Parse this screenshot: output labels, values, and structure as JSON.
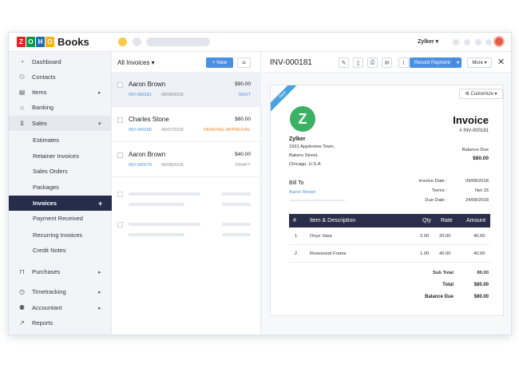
{
  "brand": {
    "logo_letters": [
      "Z",
      "O",
      "H",
      "O"
    ],
    "logo_colors": [
      "#e42527",
      "#089949",
      "#226db4",
      "#f9b21d"
    ],
    "product": "Books",
    "accent": "#4a90e2",
    "nav_active_bg": "#252d4a"
  },
  "topbar": {
    "org_name": "Zylker ▾"
  },
  "sidebar": {
    "items": [
      {
        "icon": "dashboard-icon",
        "label": "Dashboard"
      },
      {
        "icon": "contacts-icon",
        "label": "Contacts"
      },
      {
        "icon": "items-icon",
        "label": "Items",
        "chevron": "▸"
      },
      {
        "icon": "banking-icon",
        "label": "Banking"
      },
      {
        "icon": "cart-icon",
        "label": "Sales",
        "chevron": "▾"
      },
      {
        "label": "Estimates"
      },
      {
        "label": "Retainer Invoices"
      },
      {
        "label": "Sales Orders"
      },
      {
        "label": "Packages"
      },
      {
        "label": "Invoices",
        "chevron": "+"
      },
      {
        "label": "Payment Received"
      },
      {
        "label": "Recurring Invoices"
      },
      {
        "label": "Credit Notes"
      },
      {
        "icon": "bag-icon",
        "label": "Purchases",
        "chevron": "▸"
      },
      {
        "icon": "timer-icon",
        "label": "Timetracking",
        "chevron": "▸"
      },
      {
        "icon": "accountant-icon",
        "label": "Accountant",
        "chevron": "▸"
      },
      {
        "icon": "reports-icon",
        "label": "Reports"
      }
    ]
  },
  "list": {
    "title": "All Invoices ▾",
    "new_label": "+ New",
    "menu_label": "≡",
    "rows": [
      {
        "name": "Aaron Brown",
        "amount": "$90.00",
        "number": "INV-000181",
        "date": "09/08/2018",
        "status": "SENT",
        "status_color": "#4a90e2"
      },
      {
        "name": "Charles Stone",
        "amount": "$80.00",
        "number": "INV-000180",
        "date": "09/07/2018",
        "status": "PENDING APPROVAL",
        "status_color": "#f07b22"
      },
      {
        "name": "Aaron Brown",
        "amount": "$40.00",
        "number": "INV-000179",
        "date": "09/08/2018",
        "status": "DRAFT",
        "status_color": "#8a8f98"
      }
    ]
  },
  "detail": {
    "invoice_id": "INV-000181",
    "record_payment": "Record Payment",
    "more": "More ▾",
    "close": "✕",
    "ribbon": "Sent",
    "customize": "⚙ Customize ▾",
    "company": {
      "initial": "Z",
      "name": "Zylker",
      "address": [
        "1561 Appleview Town,",
        "Bakers Street,",
        "Chicago, U.S.A"
      ]
    },
    "doc_title": "Invoice",
    "doc_number": "# INV-000181",
    "balance_due_label": "Balance Due",
    "balance_due_value": "$80.00",
    "bill_to_label": "Bill To",
    "bill_to_name": "Aaron Brown",
    "meta": [
      {
        "label": "Invoice Date :",
        "value": "09/08/2018"
      },
      {
        "label": "Terms :",
        "value": "Net 15"
      },
      {
        "label": "Due Date :",
        "value": "24/08/2018"
      }
    ],
    "table": {
      "headers": [
        "#",
        "Item & Description",
        "Qty",
        "Rate",
        "Amount"
      ],
      "rows": [
        [
          "1",
          "Onyx Vase",
          "2.00",
          "20.00",
          "40.00"
        ],
        [
          "2",
          "Rosewood Frame",
          "1.00",
          "40.00",
          "40.00"
        ]
      ]
    },
    "totals": [
      {
        "label": "Sub Total",
        "value": "80.00"
      },
      {
        "label": "Total",
        "value": "$80.00"
      },
      {
        "label": "Balance Due",
        "value": "$80.00"
      }
    ]
  }
}
